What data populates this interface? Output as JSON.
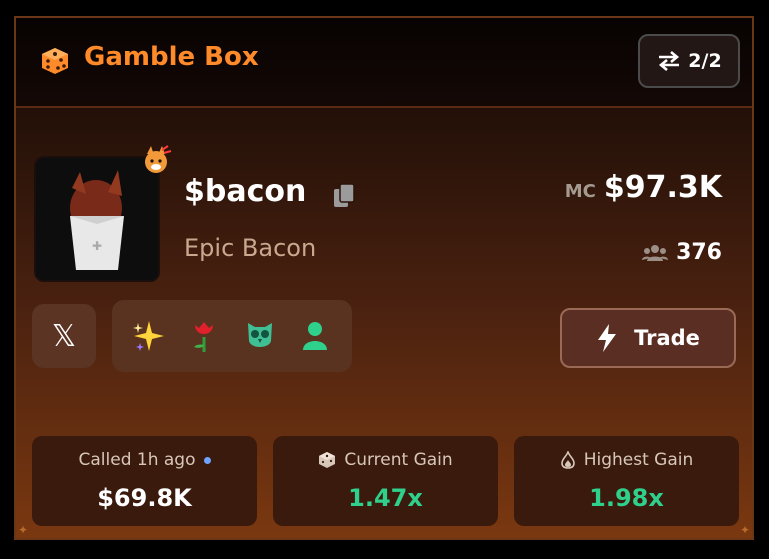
{
  "header": {
    "title": "Gamble Box",
    "title_icon": "dice-icon",
    "pager": {
      "icon": "swap-arrows-icon",
      "label": "2/2"
    }
  },
  "token": {
    "ticker": "$bacon",
    "name": "Epic Bacon",
    "image": "bacon-fries-image",
    "badge_icon": "fire-fox-icon",
    "copy_icon": "copy-icon"
  },
  "market": {
    "mc_label": "MC",
    "mc_value": "$97.3K",
    "holders_icon": "users-icon",
    "holders": "376"
  },
  "social": {
    "x_icon": "x-logo-icon",
    "x_label": "𝕏"
  },
  "badges": [
    "sparkles-icon",
    "rose-icon",
    "owl-icon",
    "user-icon"
  ],
  "trade": {
    "label": "Trade",
    "icon": "lightning-icon"
  },
  "stats": [
    {
      "label": "Called 1h ago",
      "value": "$69.8K",
      "value_color": "#ffffff",
      "icon": "dot-indicator"
    },
    {
      "label": "Current Gain",
      "value": "1.47x",
      "value_color": "#2fd08b",
      "icon": "box-icon"
    },
    {
      "label": "Highest Gain",
      "value": "1.98x",
      "value_color": "#2fd08b",
      "icon": "flame-icon"
    }
  ],
  "colors": {
    "accent": "#ff8a2a",
    "gain": "#2fd08b"
  }
}
